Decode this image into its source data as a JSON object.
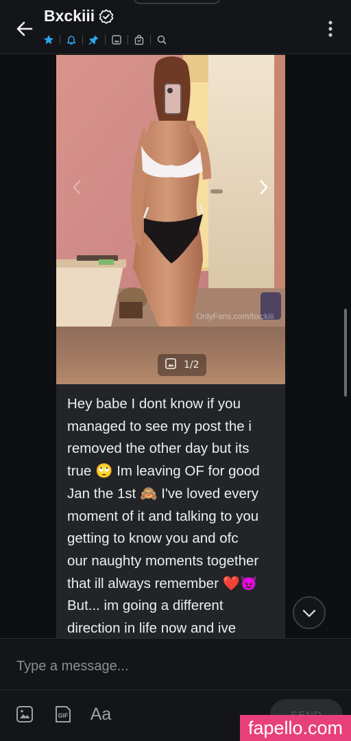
{
  "header": {
    "title": "Bxckiii",
    "verified_icon": "verified-badge-icon",
    "icons": [
      "star-icon",
      "bell-icon",
      "pin-icon",
      "image-icon",
      "shopping-bag-icon",
      "search-icon"
    ],
    "accent_color": "#2aa6f0"
  },
  "message": {
    "watermark": "OnlyFans.com/bxckiii",
    "image_counter": "1/2",
    "text_lines": [
      "Hey babe I dont know if you",
      "managed to see my post the i",
      "removed the other day but its",
      "true 🙄 Im leaving OF for good",
      "Jan the 1st 🙈 I've loved every",
      "moment of it and talking to you",
      "getting to know you and ofc",
      "our naughty moments together",
      "that ill always remember ❤️😈",
      "But... im going a different",
      "direction in life now and ive"
    ]
  },
  "composer": {
    "placeholder": "Type a message...",
    "gif_label": "GIF",
    "text_format_label": "Aa",
    "send_label": "SEND"
  },
  "watermark_badge": "fapello.com"
}
